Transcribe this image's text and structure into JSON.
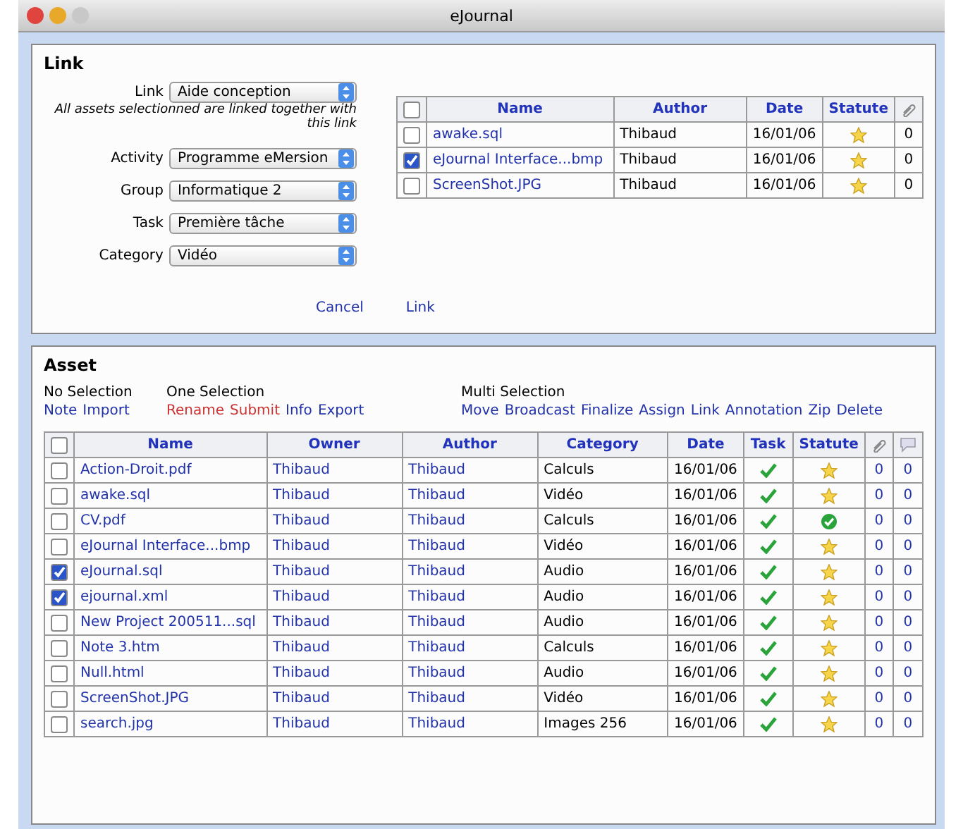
{
  "window": {
    "title": "eJournal"
  },
  "link_panel": {
    "title": "Link",
    "fields": [
      {
        "label": "Link",
        "value": "Aide conception",
        "note": "All assets selectionned are linked together with this link"
      },
      {
        "label": "Activity",
        "value": "Programme eMersion"
      },
      {
        "label": "Group",
        "value": "Informatique 2"
      },
      {
        "label": "Task",
        "value": "Première tâche"
      },
      {
        "label": "Category",
        "value": "Vidéo"
      }
    ],
    "buttons": [
      "Cancel",
      "Link"
    ],
    "table": {
      "all_checked": false,
      "columns": [
        "Name",
        "Author",
        "Date",
        "Statute"
      ],
      "rows": [
        {
          "checked": false,
          "name": "awake.sql",
          "author": "Thibaud",
          "date": "16/01/06",
          "finalized": false,
          "links": "0"
        },
        {
          "checked": true,
          "name": "eJournal Interface...bmp",
          "author": "Thibaud",
          "date": "16/01/06",
          "finalized": false,
          "links": "0"
        },
        {
          "checked": false,
          "name": "ScreenShot.JPG",
          "author": "Thibaud",
          "date": "16/01/06",
          "finalized": false,
          "links": "0"
        }
      ]
    }
  },
  "asset_panel": {
    "title": "Asset",
    "action_groups": [
      {
        "label": "No Selection",
        "actions": [
          {
            "label": "Note",
            "highlighted": false
          },
          {
            "label": "Import",
            "highlighted": false
          }
        ]
      },
      {
        "label": "One Selection",
        "actions": [
          {
            "label": "Rename",
            "highlighted": true
          },
          {
            "label": "Submit",
            "highlighted": true
          },
          {
            "label": "Info",
            "highlighted": false
          },
          {
            "label": "Export",
            "highlighted": false
          }
        ]
      },
      {
        "label": "Multi Selection",
        "actions": [
          {
            "label": "Move",
            "highlighted": false
          },
          {
            "label": "Broadcast",
            "highlighted": false
          },
          {
            "label": "Finalize",
            "highlighted": false
          },
          {
            "label": "Assign",
            "highlighted": false
          },
          {
            "label": "Link",
            "highlighted": false
          },
          {
            "label": "Annotation",
            "highlighted": false
          },
          {
            "label": "Zip",
            "highlighted": false
          },
          {
            "label": "Delete",
            "highlighted": false
          }
        ]
      }
    ],
    "table": {
      "all_checked": false,
      "columns": [
        "Name",
        "Owner",
        "Author",
        "Category",
        "Date",
        "Task",
        "Statute"
      ],
      "rows": [
        {
          "checked": false,
          "name": "Action-Droit.pdf",
          "owner": "Thibaud",
          "author": "Thibaud",
          "category": "Calculs",
          "date": "16/01/06",
          "task_done": true,
          "finalized": false,
          "links": "0",
          "comments": "0"
        },
        {
          "checked": false,
          "name": "awake.sql",
          "owner": "Thibaud",
          "author": "Thibaud",
          "category": "Vidéo",
          "date": "16/01/06",
          "task_done": true,
          "finalized": false,
          "links": "0",
          "comments": "0"
        },
        {
          "checked": false,
          "name": "CV.pdf",
          "owner": "Thibaud",
          "author": "Thibaud",
          "category": "Calculs",
          "date": "16/01/06",
          "task_done": true,
          "finalized": true,
          "links": "0",
          "comments": "0"
        },
        {
          "checked": false,
          "name": "eJournal Interface...bmp",
          "owner": "Thibaud",
          "author": "Thibaud",
          "category": "Vidéo",
          "date": "16/01/06",
          "task_done": true,
          "finalized": false,
          "links": "0",
          "comments": "0"
        },
        {
          "checked": true,
          "name": "eJournal.sql",
          "owner": "Thibaud",
          "author": "Thibaud",
          "category": "Audio",
          "date": "16/01/06",
          "task_done": true,
          "finalized": false,
          "links": "0",
          "comments": "0"
        },
        {
          "checked": true,
          "name": "ejournal.xml",
          "owner": "Thibaud",
          "author": "Thibaud",
          "category": "Audio",
          "date": "16/01/06",
          "task_done": true,
          "finalized": false,
          "links": "0",
          "comments": "0"
        },
        {
          "checked": false,
          "name": "New Project 200511...sql",
          "owner": "Thibaud",
          "author": "Thibaud",
          "category": "Audio",
          "date": "16/01/06",
          "task_done": true,
          "finalized": false,
          "links": "0",
          "comments": "0"
        },
        {
          "checked": false,
          "name": "Note 3.htm",
          "owner": "Thibaud",
          "author": "Thibaud",
          "category": "Calculs",
          "date": "16/01/06",
          "task_done": true,
          "finalized": false,
          "links": "0",
          "comments": "0"
        },
        {
          "checked": false,
          "name": "Null.html",
          "owner": "Thibaud",
          "author": "Thibaud",
          "category": "Audio",
          "date": "16/01/06",
          "task_done": true,
          "finalized": false,
          "links": "0",
          "comments": "0"
        },
        {
          "checked": false,
          "name": "ScreenShot.JPG",
          "owner": "Thibaud",
          "author": "Thibaud",
          "category": "Vidéo",
          "date": "16/01/06",
          "task_done": true,
          "finalized": false,
          "links": "0",
          "comments": "0"
        },
        {
          "checked": false,
          "name": "search.jpg",
          "owner": "Thibaud",
          "author": "Thibaud",
          "category": "Images 256",
          "date": "16/01/06",
          "task_done": true,
          "finalized": false,
          "links": "0",
          "comments": "0"
        }
      ]
    }
  }
}
